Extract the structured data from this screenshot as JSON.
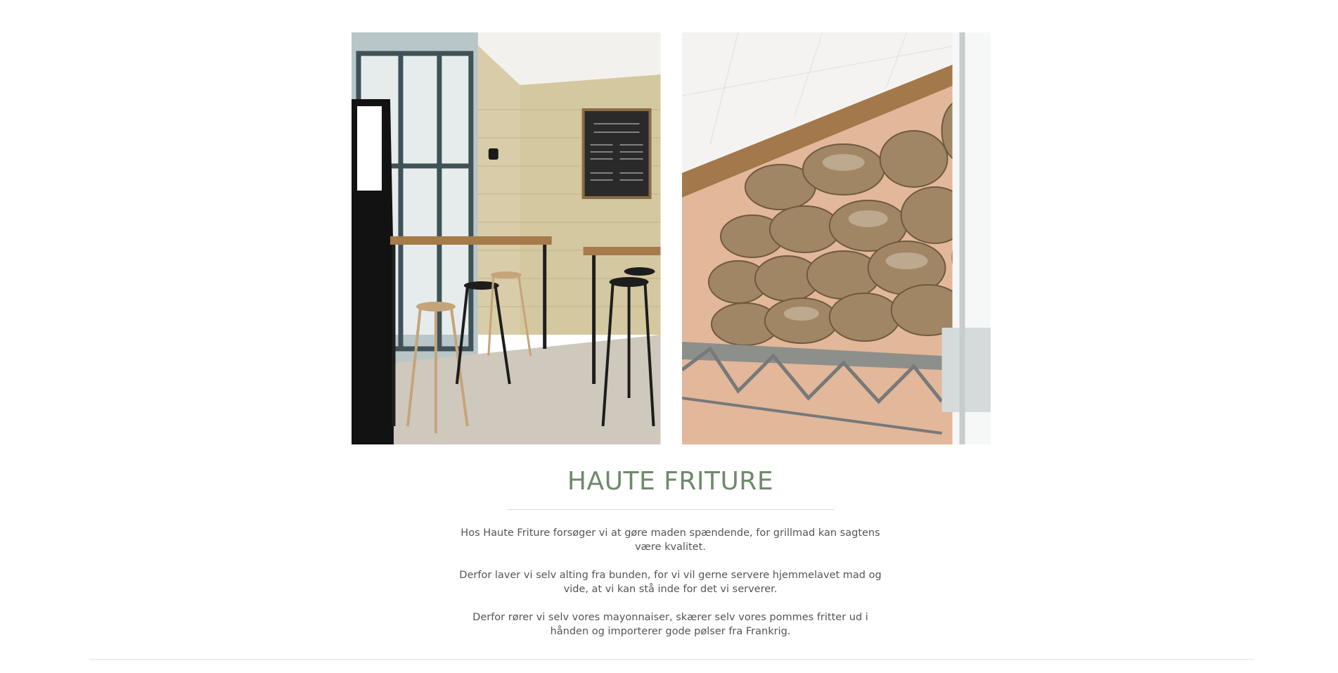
{
  "section": {
    "title": "HAUTE FRITURE",
    "paragraphs": [
      "Hos Haute Friture forsøger vi at gøre maden spændende, for grillmad kan sagtens være kvalitet.",
      "Derfor laver vi selv alting fra bunden, for vi vil gerne servere hjemmelavet mad og vide, at vi kan stå inde for det vi serverer.",
      "Derfor rører vi selv vores mayonnaiser, skærer selv vores pommes fritter ud i hånden og importerer gode pølser fra Frankrig."
    ]
  },
  "colors": {
    "title": "#6e8a6a",
    "body_text": "#555555",
    "rule": "#d9d9d9"
  }
}
